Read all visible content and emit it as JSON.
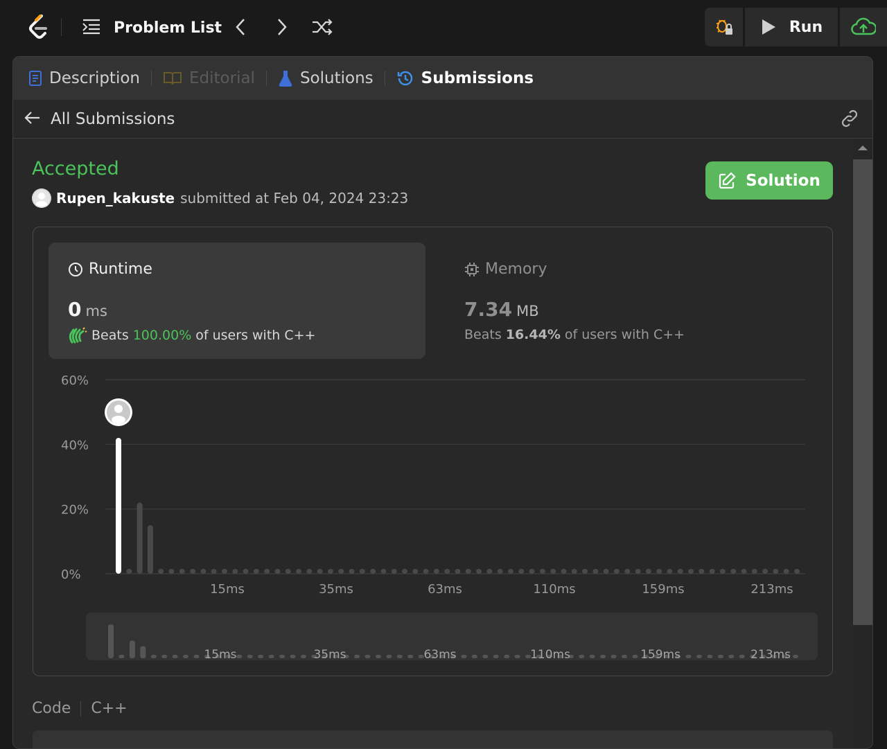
{
  "topbar": {
    "problem_list_label": "Problem List",
    "run_label": "Run",
    "icons": [
      "leetcode-logo",
      "list-icon",
      "chevron-left-icon",
      "chevron-right-icon",
      "shuffle-icon",
      "debug-lock-icon",
      "play-icon",
      "cloud-upload-icon"
    ]
  },
  "tabs": [
    {
      "label": "Description",
      "icon": "document-icon"
    },
    {
      "label": "Editorial",
      "icon": "book-icon"
    },
    {
      "label": "Solutions",
      "icon": "flask-icon"
    },
    {
      "label": "Submissions",
      "icon": "history-icon"
    }
  ],
  "subheader": {
    "back_label": "All Submissions"
  },
  "submission": {
    "status": "Accepted",
    "user": "Rupen_kakuste",
    "submitted_text": "submitted at Feb 04, 2024 23:23",
    "solution_button": "Solution"
  },
  "runtime": {
    "title": "Runtime",
    "value": "0",
    "unit": "ms",
    "beats_prefix": "Beats",
    "beats_pct": "100.00%",
    "beats_suffix": "of users with C++"
  },
  "memory": {
    "title": "Memory",
    "value": "7.34",
    "unit": "MB",
    "beats_prefix": "Beats",
    "beats_pct": "16.44%",
    "beats_suffix": "of users with C++"
  },
  "chart_data": {
    "type": "bar",
    "ytick_labels": [
      "60%",
      "40%",
      "20%",
      "0%"
    ],
    "ylim": [
      0,
      60
    ],
    "xtick_labels": [
      "15ms",
      "35ms",
      "63ms",
      "110ms",
      "159ms",
      "213ms"
    ],
    "values": [
      42,
      0.6,
      22,
      15,
      0.6,
      0.6,
      0.6,
      0.6,
      0.6,
      0.6,
      0.6,
      0.6,
      0.6,
      0.6,
      0.6,
      0.6,
      0.6,
      0.6,
      0.6,
      0.6,
      0.6,
      0.6,
      0.6,
      0.6,
      0.6,
      0.6,
      0.6,
      0.6,
      0.6,
      0.6,
      0.6,
      0.6,
      0.6,
      0.6,
      0.6,
      0.6,
      0.6,
      0.6,
      0.6,
      0.6,
      0.6,
      0.6,
      0.6,
      0.6,
      0.6,
      0.6,
      0.6,
      0.6,
      0.6,
      0.6,
      0.6,
      0.6,
      0.6,
      0.6,
      0.6,
      0.6,
      0.6,
      0.6,
      0.6,
      0.6,
      0.6,
      0.6,
      0.6,
      0.6,
      0.6
    ],
    "highlight_index": 0,
    "grid": true,
    "colors": {
      "highlight": "#ffffff",
      "bar": "#4a4a4a",
      "grid": "#3e3e3e"
    }
  },
  "code": {
    "label": "Code",
    "language": "C++"
  }
}
